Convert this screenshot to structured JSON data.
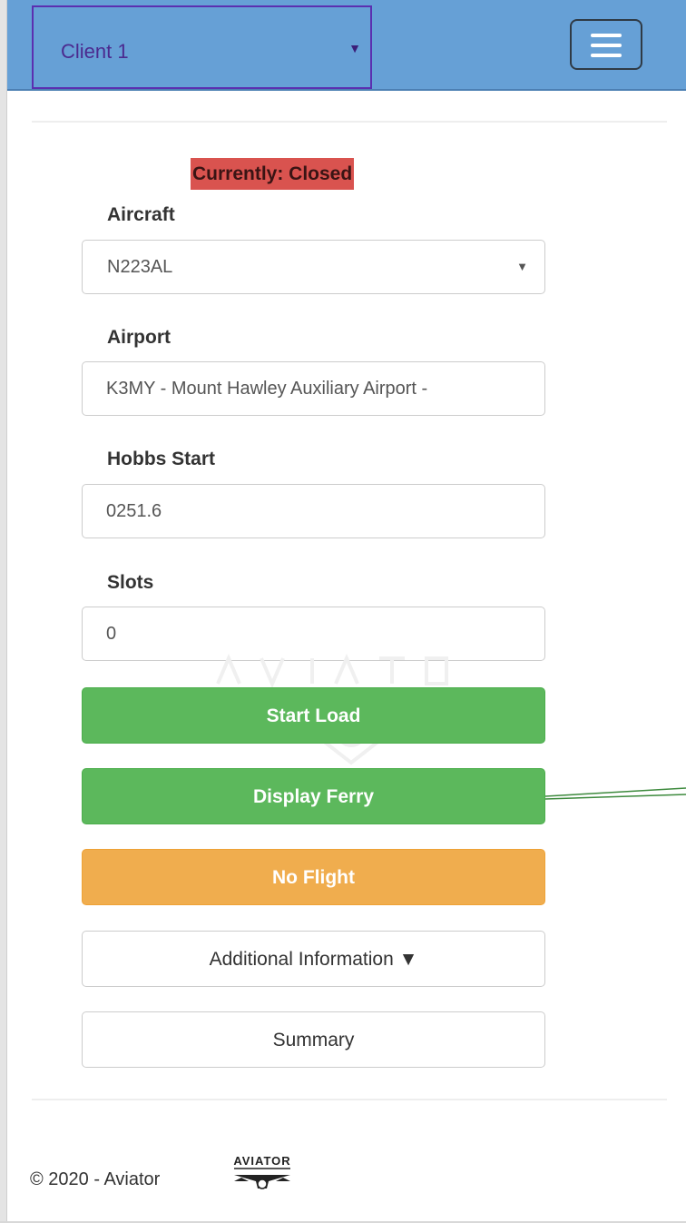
{
  "navbar": {
    "client_select": {
      "value": "Client 1"
    },
    "menu_button": {
      "icon": "hamburger-icon"
    },
    "bg_color": "#66a0d6"
  },
  "status": {
    "text": "Currently: Closed",
    "color": "#d9534f"
  },
  "form": {
    "aircraft": {
      "label": "Aircraft",
      "value": "N223AL"
    },
    "airport": {
      "label": "Airport",
      "value": "K3MY - Mount Hawley Auxiliary Airport -"
    },
    "hobbs_start": {
      "label": "Hobbs Start",
      "value": "0251.6"
    },
    "slots": {
      "label": "Slots",
      "value": "0"
    }
  },
  "buttons": {
    "start_load": "Start Load",
    "display_ferry": "Display Ferry",
    "no_flight": "No Flight",
    "additional_info": "Additional Information ▼",
    "summary": "Summary"
  },
  "colors": {
    "success": "#5cb85c",
    "warning": "#f0ad4e",
    "annotation": "#3d8a3d"
  },
  "footer": {
    "text": "© 2020 - Aviator",
    "logo_text": "AVIATOR"
  }
}
